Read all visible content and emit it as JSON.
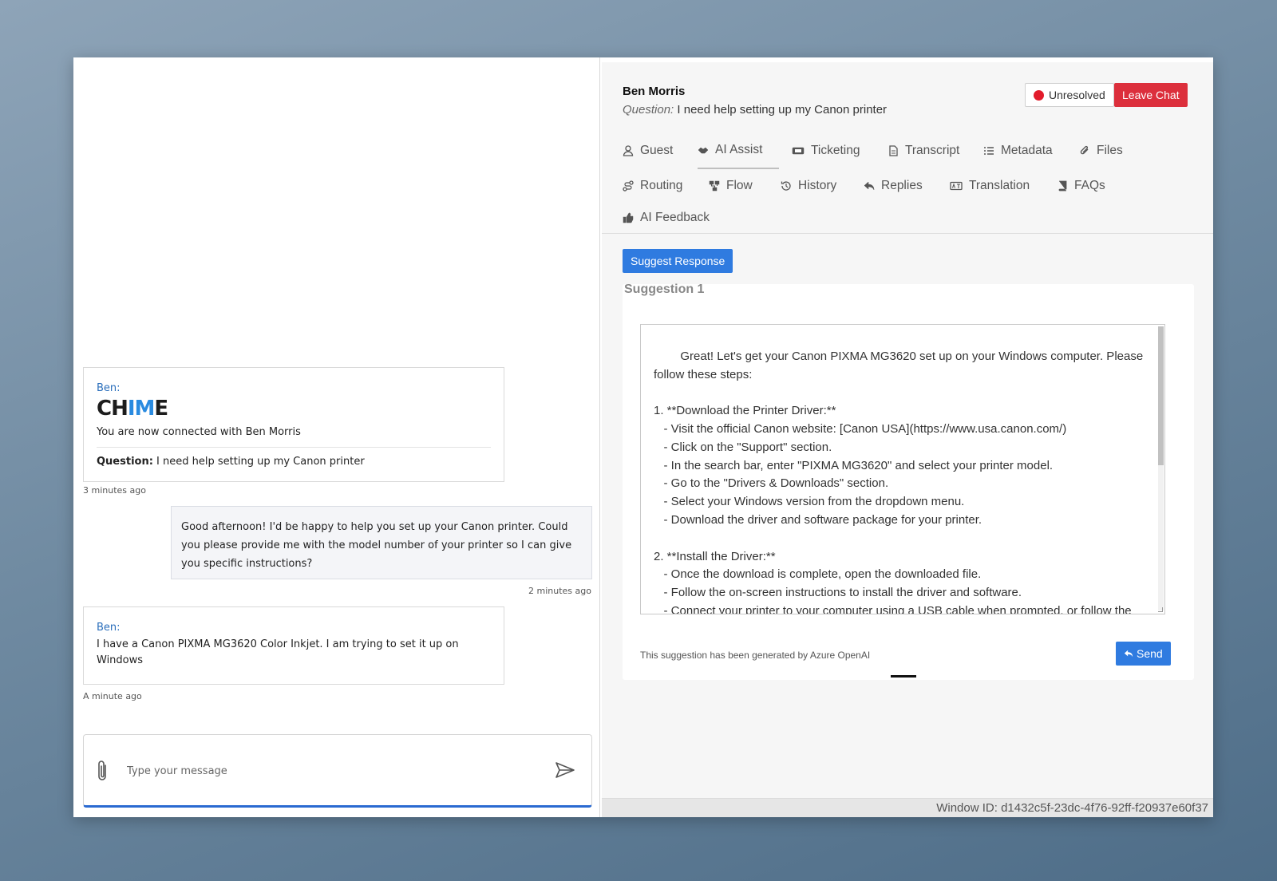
{
  "chat": {
    "welcome": {
      "sender": "Ben:",
      "logo_text": [
        "CH",
        "IM",
        "E"
      ],
      "connected_text": "You are now connected with Ben Morris",
      "question_label": "Question:",
      "question_text": " I need help setting up my Canon printer",
      "time": "3 minutes ago"
    },
    "agent_message": {
      "text": "Good afternoon! I'd be happy to help you set up your Canon printer. Could you please provide me with the model number of your printer so I can give you specific instructions?",
      "time": "2 minutes ago"
    },
    "guest_message": {
      "sender": "Ben:",
      "text": "I have a Canon PIXMA MG3620 Color Inkjet. I am trying to set it up on Windows",
      "time": "A minute ago"
    },
    "composer": {
      "placeholder": "Type your message"
    }
  },
  "agent": {
    "guest_name": "Ben Morris",
    "question_label": "Question:",
    "question_text": " I need help setting up my Canon printer",
    "status_label": "Unresolved",
    "status_color": "#e21b2b",
    "leave_label": "Leave Chat",
    "tabs": [
      {
        "label": "Guest",
        "icon": "user-icon"
      },
      {
        "label": "AI Assist",
        "icon": "handshake-icon"
      },
      {
        "label": "Ticketing",
        "icon": "ticket-icon"
      },
      {
        "label": "Transcript",
        "icon": "file-icon"
      },
      {
        "label": "Metadata",
        "icon": "list-icon"
      },
      {
        "label": "Files",
        "icon": "paperclip-icon"
      },
      {
        "label": "Routing",
        "icon": "route-icon"
      },
      {
        "label": "Flow",
        "icon": "sitemap-icon"
      },
      {
        "label": "History",
        "icon": "history-icon"
      },
      {
        "label": "Replies",
        "icon": "reply-icon"
      },
      {
        "label": "Translation",
        "icon": "language-icon"
      },
      {
        "label": "FAQs",
        "icon": "book-icon"
      },
      {
        "label": "AI Feedback",
        "icon": "thumbs-up-icon"
      }
    ],
    "active_tab": "AI Assist",
    "suggest_label": "Suggest Response",
    "suggestion_title": "Suggestion 1",
    "suggestion_text": "Great! Let's get your Canon PIXMA MG3620 set up on your Windows computer. Please follow these steps:\n\n1. **Download the Printer Driver:**\n   - Visit the official Canon website: [Canon USA](https://www.usa.canon.com/)\n   - Click on the \"Support\" section.\n   - In the search bar, enter \"PIXMA MG3620\" and select your printer model.\n   - Go to the \"Drivers & Downloads\" section.\n   - Select your Windows version from the dropdown menu.\n   - Download the driver and software package for your printer.\n\n2. **Install the Driver:**\n   - Once the download is complete, open the downloaded file.\n   - Follow the on-screen instructions to install the driver and software.\n   - Connect your printer to your computer using a USB cable when prompted, or follow the instructions for wireless setup.",
    "generated_note": "This suggestion has been generated by Azure OpenAI",
    "send_label": "Send",
    "window_id": "Window ID: d1432c5f-23dc-4f76-92ff-f20937e60f37",
    "accent_color": "#2f7be0",
    "danger_color": "#dc2f3c"
  }
}
